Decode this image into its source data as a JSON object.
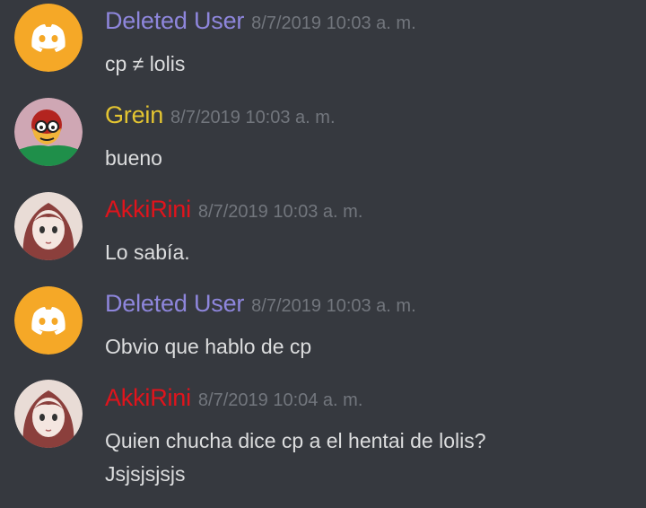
{
  "colors": {
    "background": "#36393f",
    "timestamp": "#72767d",
    "text": "#dcddde",
    "deleted_user": "#8e86dc",
    "grein": "#e4c531",
    "akkirini": "#e0141c",
    "discord_avatar_bg": "#f5a827"
  },
  "messages": [
    {
      "author": "Deleted User",
      "timestamp": "8/7/2019 10:03 a. m.",
      "avatar": "discord-logo-icon",
      "lines": [
        "cp ≠ lolis"
      ]
    },
    {
      "author": "Grein",
      "timestamp": "8/7/2019 10:03 a. m.",
      "avatar": "cartoon-avatar",
      "lines": [
        "bueno"
      ]
    },
    {
      "author": "AkkiRini",
      "timestamp": "8/7/2019 10:03 a. m.",
      "avatar": "anime-girl-avatar",
      "lines": [
        "Lo sabía."
      ]
    },
    {
      "author": "Deleted User",
      "timestamp": "8/7/2019 10:03 a. m.",
      "avatar": "discord-logo-icon",
      "lines": [
        "Obvio que hablo de cp"
      ]
    },
    {
      "author": "AkkiRini",
      "timestamp": "8/7/2019 10:04 a. m.",
      "avatar": "anime-girl-avatar",
      "lines": [
        "Quien chucha dice cp a el hentai de lolis?",
        "Jsjsjsjsjs"
      ]
    }
  ]
}
